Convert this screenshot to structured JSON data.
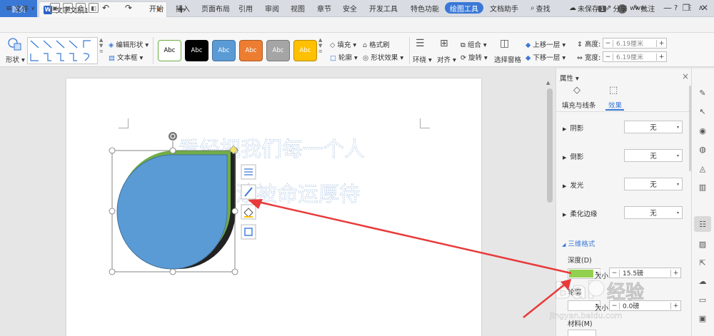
{
  "titlebar": {
    "home_tab": "首页",
    "doc_tab": "文字文稿1",
    "doc_icon": "W",
    "new_tab": "+",
    "page_badge": "1",
    "user": "www."
  },
  "menubar": {
    "file": "文件",
    "items": [
      "开始",
      "插入",
      "页面布局",
      "引用",
      "审阅",
      "视图",
      "章节",
      "安全",
      "开发工具",
      "特色功能",
      "绘图工具",
      "文档助手"
    ],
    "active": "绘图工具",
    "search": "查找",
    "unsaved": "未保存",
    "share": "分享",
    "annotate": "批注",
    "help": "?"
  },
  "ribbon": {
    "shape_label": "形状",
    "edit_shape": "编辑形状",
    "textbox": "文本框",
    "style_swatches": [
      {
        "label": "Abc",
        "bg": "#ffffff",
        "fg": "#000000",
        "border": "#70ad47"
      },
      {
        "label": "Abc",
        "bg": "#000000",
        "fg": "#ffffff",
        "border": "#000000"
      },
      {
        "label": "Abc",
        "bg": "#5b9bd5",
        "fg": "#ffffff",
        "border": "#41719c"
      },
      {
        "label": "Abc",
        "bg": "#ed7d31",
        "fg": "#ffffff",
        "border": "#ae5a21"
      },
      {
        "label": "Abc",
        "bg": "#a5a5a5",
        "fg": "#ffffff",
        "border": "#787878"
      },
      {
        "label": "Abc",
        "bg": "#ffc000",
        "fg": "#ffffff",
        "border": "#bc8c00"
      }
    ],
    "fill": "填充",
    "format_painter": "格式刷",
    "outline": "轮廓",
    "shape_effects": "形状效果",
    "wrap": "环绕",
    "align": "对齐",
    "group": "组合",
    "rotate": "旋转",
    "selection_pane": "选择窗格",
    "bring_forward": "上移一层",
    "send_backward": "下移一层",
    "height_label": "高度:",
    "height_value": "6.19厘米",
    "width_label": "宽度:",
    "width_value": "6.19厘米",
    "minus": "−",
    "plus": "+"
  },
  "document": {
    "line1": "看经把我们每一个人",
    "line2": "涂被命运厚待"
  },
  "props": {
    "title": "属性",
    "close": "×",
    "tab_fill": "填充与线条",
    "tab_effect": "效果",
    "rows": [
      {
        "label": "阴影",
        "value": "无"
      },
      {
        "label": "倒影",
        "value": "无"
      },
      {
        "label": "发光",
        "value": "无"
      },
      {
        "label": "柔化边缘",
        "value": "无"
      }
    ],
    "section_3d": "三维格式",
    "depth_label": "深度(D)",
    "depth_color": "#92d050",
    "size_label": "大小",
    "depth_size": "15.5磅",
    "contour_label": "轮廓",
    "contour_size": "0.0磅",
    "material_label": "材料(M)"
  },
  "watermark": {
    "text": "Bai",
    "text2": "经验",
    "url": "jingyan.baidu.com"
  },
  "colors": {
    "accent": "#3a78d6",
    "shape_fill": "#5b9bd5",
    "shape_outline": "#41719c",
    "depth_green": "#70ad47",
    "arrow_red": "#e83a3a"
  }
}
